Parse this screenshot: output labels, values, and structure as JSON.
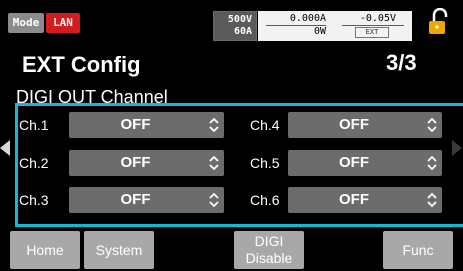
{
  "status": {
    "mode_badge": "Mode",
    "lan_badge": "LAN",
    "rated_voltage": "500V",
    "rated_current": "60A",
    "current_reading": "0.000A",
    "power_reading": "0W",
    "voltage_reading": "-0.05V",
    "ext_tag": "EXT",
    "lock_icon": "lock-open-icon"
  },
  "header": {
    "title": "EXT Config",
    "page_counter": "3/3"
  },
  "section": {
    "title": "DIGI OUT Channel"
  },
  "channels": [
    {
      "label": "Ch.1",
      "value": "OFF"
    },
    {
      "label": "Ch.2",
      "value": "OFF"
    },
    {
      "label": "Ch.3",
      "value": "OFF"
    },
    {
      "label": "Ch.4",
      "value": "OFF"
    },
    {
      "label": "Ch.5",
      "value": "OFF"
    },
    {
      "label": "Ch.6",
      "value": "OFF"
    }
  ],
  "function_keys": {
    "home": "Home",
    "system": "System",
    "digi_line1": "DIGI",
    "digi_line2": "Disable",
    "func": "Func"
  },
  "colors": {
    "selection_frame": "#16b6d6",
    "lan_badge": "#d41c1c",
    "lock_accent": "#f0a800"
  }
}
